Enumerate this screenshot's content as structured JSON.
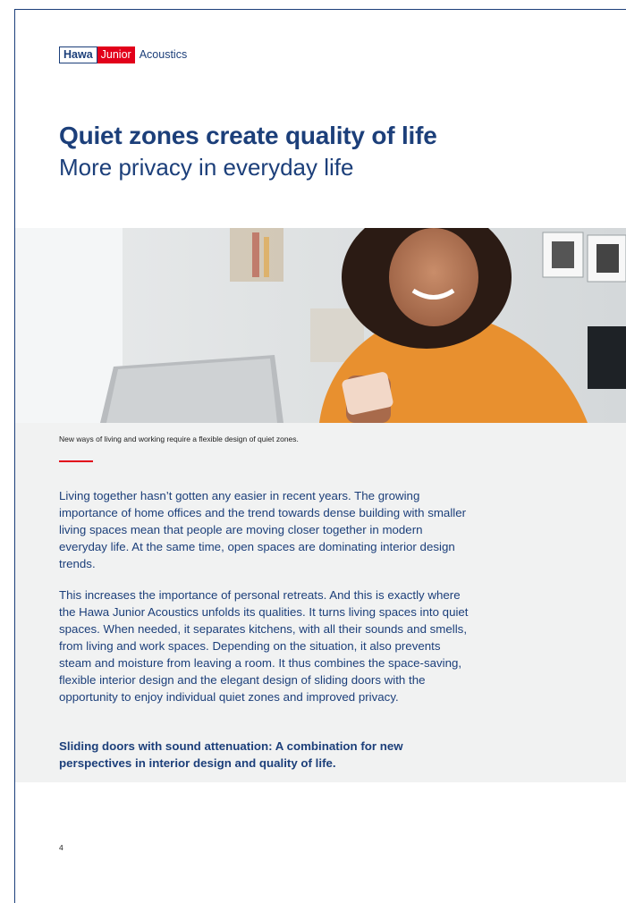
{
  "brand": {
    "name_part1": "Hawa",
    "name_part2": "Junior",
    "name_part3": "Acoustics"
  },
  "colors": {
    "brand_blue": "#1c3f7a",
    "brand_red": "#e2001a",
    "panel_grey": "#f1f2f2"
  },
  "title": "Quiet zones create quality of life",
  "subtitle": "More privacy in everyday life",
  "photo_caption": "New ways of living and working require a flexible design of quiet zones.",
  "paragraphs": [
    "Living together hasn’t gotten any easier in recent years. The growing importance of home offices and the trend towards dense building with smaller living spaces mean that people are moving closer together in modern everyday life. At the same time, open spaces are dominating interior design trends.",
    "This increases the importance of personal retreats. And this is exactly where the Hawa Junior Acoustics unfolds its qualities. It turns living spaces into quiet spaces. When needed, it separates kitchens, with all their sounds and smells, from living and work spaces. Depending on the situation, it also prevents steam and moisture from leaving a room. It thus combines the space-saving, flexible interior design and the elegant design of sliding doors with the opportunity to enjoy individual quiet zones and improved privacy.",
    "Sliding doors with sound attenuation: A combination for new perspectives in interior design and quality of life."
  ],
  "page_number": "4"
}
